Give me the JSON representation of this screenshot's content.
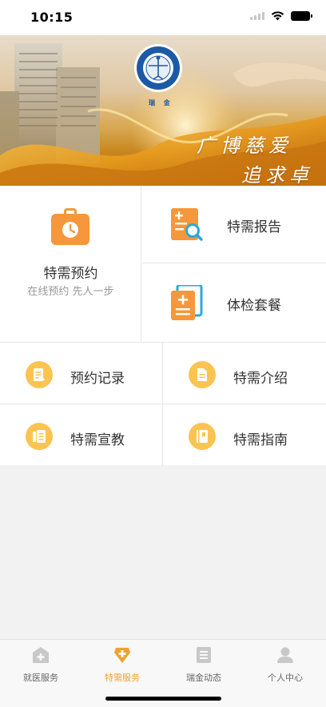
{
  "status_bar": {
    "time": "10:15"
  },
  "banner": {
    "slogan_line1": "广博慈爱",
    "slogan_line2": "追求卓越",
    "logo_text": "瑞 金"
  },
  "main_card": {
    "title": "特需预约",
    "subtitle": "在线预约 先人一步",
    "icon": "clock-bag-icon"
  },
  "side_cards": [
    {
      "label": "特需报告",
      "icon": "report-search-icon"
    },
    {
      "label": "体检套餐",
      "icon": "checkup-package-icon"
    }
  ],
  "grid_items": [
    {
      "label": "预约记录",
      "icon": "record-icon"
    },
    {
      "label": "特需介绍",
      "icon": "document-icon"
    },
    {
      "label": "特需宣教",
      "icon": "education-icon"
    },
    {
      "label": "特需指南",
      "icon": "guide-icon"
    }
  ],
  "tabbar": {
    "items": [
      {
        "label": "就医服务",
        "icon": "hospital-icon"
      },
      {
        "label": "特需服务",
        "icon": "special-service-icon"
      },
      {
        "label": "瑞金动态",
        "icon": "news-icon"
      },
      {
        "label": "个人中心",
        "icon": "user-icon"
      }
    ],
    "active_index": 1
  },
  "colors": {
    "accent": "#f0a22c",
    "icon_orange": "#f5973a",
    "icon_yellow": "#fbc451",
    "inactive": "#c8c8c8"
  }
}
